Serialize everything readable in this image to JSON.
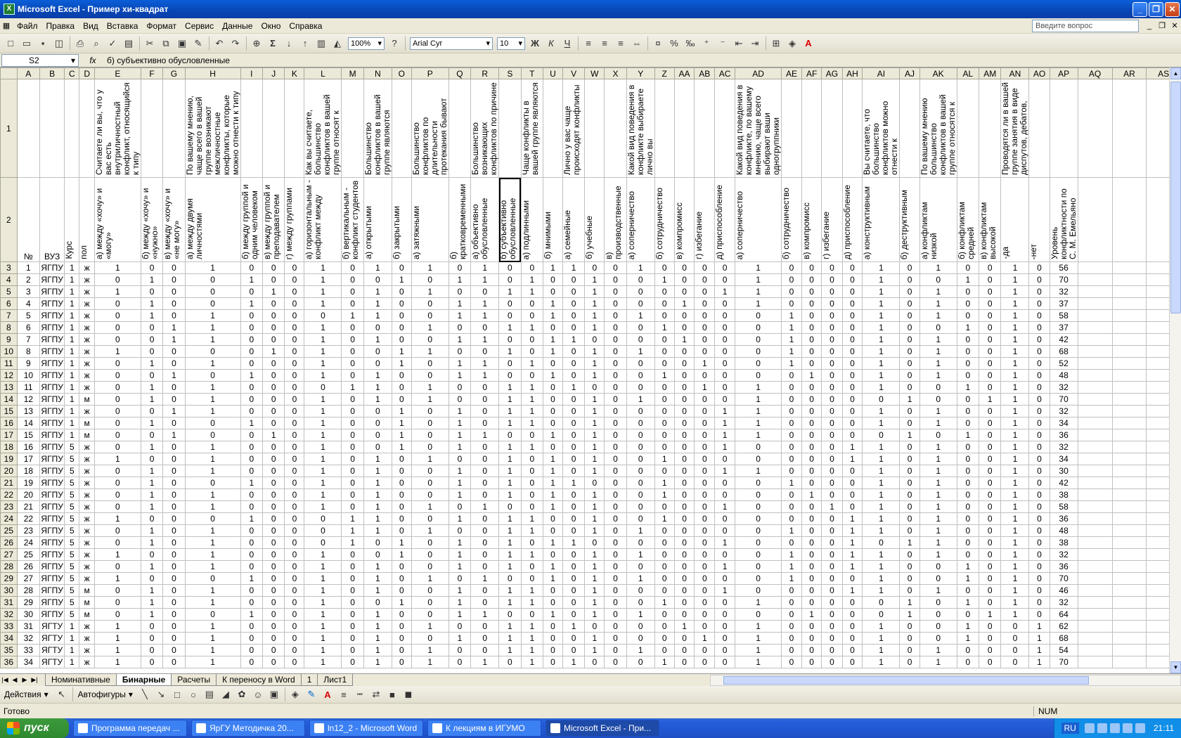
{
  "window": {
    "title": "Microsoft Excel - Пример хи-квадрат"
  },
  "menu": {
    "items": [
      "Файл",
      "Правка",
      "Вид",
      "Вставка",
      "Формат",
      "Сервис",
      "Данные",
      "Окно",
      "Справка"
    ],
    "help_placeholder": "Введите вопрос"
  },
  "toolbar": {
    "zoom": "100%",
    "font": "Arial Cyr",
    "size": "10"
  },
  "formula_bar": {
    "cell": "S2",
    "fx": "fx",
    "content": "б) субъективно обусловленные"
  },
  "columns": [
    "A",
    "B",
    "C",
    "D",
    "E",
    "F",
    "G",
    "H",
    "I",
    "J",
    "K",
    "L",
    "M",
    "N",
    "O",
    "P",
    "Q",
    "R",
    "S",
    "T",
    "U",
    "V",
    "W",
    "X",
    "Y",
    "Z",
    "AA",
    "AB",
    "AC",
    "AD",
    "AE",
    "AF",
    "AG",
    "AH",
    "AI",
    "AJ",
    "AK",
    "AL",
    "AM",
    "AN",
    "AO",
    "AP",
    "AQ",
    "AR",
    "AS"
  ],
  "row1": [
    "",
    "",
    "",
    "",
    "Считаете ли вы, что у вас есть внутриличностный конфликт, относящийся к типу",
    "",
    "",
    "По вашему мнению, чаще всего в вашей группе возникают межличностные конфликты, которые можно отнести к типу",
    "",
    "",
    "",
    "Как вы считаете, большинство конфликтов в вашей группе относят к",
    "",
    "Большинство конфликтов в вашей группе являются",
    "",
    "Большинство конфликтов по длительности протекания бывают",
    "",
    "Большинство возникающих конфликтов по причине",
    "",
    "Чаще конфликты в вашей группе являются",
    "",
    "Лично у вас чаще происходят конфликты",
    "",
    "",
    "Какой вид поведения в конфликте выбираете лично вы",
    "",
    "",
    "",
    "",
    "Какой вид поведения в конфликте, по вашему мнению, чаще всего выбирают ваши одногруппники",
    "",
    "",
    "",
    "",
    "Вы считаете, что большинство конфликтов можно отнести к",
    "",
    "По вашему мнению большинство конфликтов в вашей группе относятся к",
    "",
    "",
    "Проводятся ли в вашей группе занятия в виде диспутов, дебатов,",
    "",
    "",
    "",
    "",
    ""
  ],
  "row2": [
    "№",
    "ВУЗ",
    "Курс",
    "пол",
    "а) между «хочу» и «могу»",
    "б) между «хочу» и «нужно»",
    "в) между «хочу» и «не могу»",
    "а) между двумя личностями",
    "б) между группой и одним человеком",
    "в) между группой и преподавателем",
    "г) между группами",
    "а) горизонтальным - конфликт между",
    "б) вертикальным - конфликт студентов",
    "а) открытыми",
    "б) закрытыми",
    "а) затяжными",
    "б) кратковременными",
    "а) объективно обусловленные",
    "б) субъективно обусловленные",
    "а) подлинными",
    "б) мнимыми",
    "а) семейные",
    "б) учебные",
    "в) производственные",
    "а) соперничество",
    "б) сотрудничество",
    "в) компромисс",
    "г) избегание",
    "д) приспособление",
    "а) соперничество",
    "б) сотрудничество",
    "в) компромисс",
    "г) избегание",
    "д) приспособление",
    "а) конструктивным",
    "б) деструктивным",
    "а) конфликтам низкой",
    "б) конфликтам средней",
    "в) конфликтам высокой",
    "-да",
    "-нет",
    "Уровень конфликтности по С. М. Емельяно",
    "",
    "",
    ""
  ],
  "rows": [
    [
      "1",
      "ЯГПУ",
      "1",
      "ж",
      "1",
      "0",
      "0",
      "1",
      "0",
      "0",
      "0",
      "1",
      "0",
      "1",
      "0",
      "1",
      "0",
      "1",
      "0",
      "0",
      "1",
      "1",
      "0",
      "0",
      "1",
      "0",
      "0",
      "0",
      "0",
      "1",
      "0",
      "0",
      "0",
      "0",
      "1",
      "0",
      "1",
      "0",
      "0",
      "1",
      "0",
      "56"
    ],
    [
      "2",
      "ЯГПУ",
      "1",
      "ж",
      "0",
      "1",
      "0",
      "0",
      "1",
      "0",
      "0",
      "1",
      "0",
      "0",
      "1",
      "0",
      "1",
      "1",
      "0",
      "1",
      "0",
      "0",
      "1",
      "0",
      "0",
      "1",
      "0",
      "0",
      "0",
      "1",
      "0",
      "0",
      "0",
      "0",
      "1",
      "0",
      "0",
      "1",
      "0",
      "1",
      "0",
      "70"
    ],
    [
      "3",
      "ЯГПУ",
      "1",
      "ж",
      "1",
      "0",
      "0",
      "0",
      "0",
      "1",
      "0",
      "1",
      "0",
      "1",
      "0",
      "1",
      "0",
      "0",
      "1",
      "1",
      "0",
      "0",
      "1",
      "0",
      "0",
      "0",
      "0",
      "0",
      "1",
      "1",
      "0",
      "0",
      "0",
      "0",
      "1",
      "0",
      "1",
      "0",
      "0",
      "1",
      "0",
      "32"
    ],
    [
      "4",
      "ЯГПУ",
      "1",
      "ж",
      "0",
      "1",
      "0",
      "0",
      "1",
      "0",
      "0",
      "1",
      "0",
      "1",
      "0",
      "0",
      "1",
      "1",
      "0",
      "0",
      "1",
      "0",
      "1",
      "0",
      "0",
      "0",
      "1",
      "0",
      "0",
      "1",
      "0",
      "0",
      "0",
      "0",
      "1",
      "0",
      "1",
      "0",
      "0",
      "1",
      "0",
      "37"
    ],
    [
      "5",
      "ЯГПУ",
      "1",
      "ж",
      "0",
      "1",
      "0",
      "1",
      "0",
      "0",
      "0",
      "0",
      "1",
      "1",
      "0",
      "0",
      "1",
      "1",
      "0",
      "0",
      "1",
      "0",
      "1",
      "0",
      "1",
      "0",
      "0",
      "0",
      "0",
      "0",
      "1",
      "0",
      "0",
      "0",
      "1",
      "0",
      "1",
      "0",
      "0",
      "1",
      "0",
      "58"
    ],
    [
      "6",
      "ЯГПУ",
      "1",
      "ж",
      "0",
      "0",
      "1",
      "1",
      "0",
      "0",
      "0",
      "1",
      "0",
      "0",
      "0",
      "1",
      "0",
      "0",
      "1",
      "1",
      "0",
      "0",
      "1",
      "0",
      "0",
      "1",
      "0",
      "0",
      "0",
      "0",
      "1",
      "0",
      "0",
      "0",
      "1",
      "0",
      "0",
      "1",
      "0",
      "1",
      "0",
      "37"
    ],
    [
      "7",
      "ЯГПУ",
      "1",
      "ж",
      "0",
      "0",
      "1",
      "1",
      "0",
      "0",
      "0",
      "1",
      "0",
      "1",
      "0",
      "0",
      "1",
      "1",
      "0",
      "0",
      "1",
      "1",
      "0",
      "0",
      "0",
      "0",
      "1",
      "0",
      "0",
      "0",
      "1",
      "0",
      "0",
      "0",
      "1",
      "0",
      "1",
      "0",
      "0",
      "1",
      "0",
      "42"
    ],
    [
      "8",
      "ЯГПУ",
      "1",
      "ж",
      "1",
      "0",
      "0",
      "0",
      "0",
      "1",
      "0",
      "1",
      "0",
      "0",
      "1",
      "1",
      "0",
      "0",
      "1",
      "0",
      "1",
      "0",
      "1",
      "0",
      "1",
      "0",
      "0",
      "0",
      "0",
      "0",
      "1",
      "0",
      "0",
      "0",
      "1",
      "0",
      "1",
      "0",
      "0",
      "1",
      "0",
      "68"
    ],
    [
      "9",
      "ЯГПУ",
      "1",
      "ж",
      "0",
      "1",
      "0",
      "1",
      "0",
      "0",
      "0",
      "1",
      "0",
      "0",
      "1",
      "0",
      "1",
      "1",
      "0",
      "1",
      "0",
      "0",
      "1",
      "0",
      "0",
      "0",
      "0",
      "1",
      "0",
      "0",
      "1",
      "0",
      "0",
      "0",
      "1",
      "0",
      "1",
      "0",
      "0",
      "1",
      "0",
      "52"
    ],
    [
      "10",
      "ЯГПУ",
      "1",
      "ж",
      "0",
      "0",
      "1",
      "0",
      "1",
      "0",
      "0",
      "1",
      "0",
      "1",
      "0",
      "0",
      "1",
      "1",
      "0",
      "0",
      "1",
      "0",
      "1",
      "0",
      "0",
      "1",
      "0",
      "0",
      "0",
      "0",
      "0",
      "1",
      "0",
      "0",
      "1",
      "0",
      "1",
      "0",
      "0",
      "1",
      "0",
      "48"
    ],
    [
      "11",
      "ЯГПУ",
      "1",
      "ж",
      "0",
      "1",
      "0",
      "1",
      "0",
      "0",
      "0",
      "0",
      "1",
      "1",
      "0",
      "1",
      "0",
      "0",
      "1",
      "1",
      "0",
      "1",
      "0",
      "0",
      "0",
      "0",
      "0",
      "1",
      "0",
      "1",
      "0",
      "0",
      "0",
      "0",
      "1",
      "0",
      "0",
      "1",
      "0",
      "1",
      "0",
      "32"
    ],
    [
      "12",
      "ЯГПУ",
      "1",
      "м",
      "0",
      "1",
      "0",
      "1",
      "0",
      "0",
      "0",
      "1",
      "0",
      "1",
      "0",
      "1",
      "0",
      "0",
      "1",
      "1",
      "0",
      "0",
      "1",
      "0",
      "1",
      "0",
      "0",
      "0",
      "0",
      "1",
      "0",
      "0",
      "0",
      "0",
      "0",
      "1",
      "0",
      "0",
      "1",
      "1",
      "0",
      "70"
    ],
    [
      "13",
      "ЯГПУ",
      "1",
      "ж",
      "0",
      "0",
      "1",
      "1",
      "0",
      "0",
      "0",
      "1",
      "0",
      "0",
      "1",
      "0",
      "1",
      "0",
      "1",
      "1",
      "0",
      "0",
      "1",
      "0",
      "0",
      "0",
      "0",
      "0",
      "1",
      "1",
      "0",
      "0",
      "0",
      "0",
      "1",
      "0",
      "1",
      "0",
      "0",
      "1",
      "0",
      "32"
    ],
    [
      "14",
      "ЯГПУ",
      "1",
      "м",
      "0",
      "1",
      "0",
      "0",
      "1",
      "0",
      "0",
      "1",
      "0",
      "0",
      "1",
      "0",
      "1",
      "0",
      "1",
      "1",
      "0",
      "0",
      "1",
      "0",
      "0",
      "0",
      "0",
      "0",
      "1",
      "1",
      "0",
      "0",
      "0",
      "0",
      "1",
      "0",
      "1",
      "0",
      "0",
      "1",
      "0",
      "34"
    ],
    [
      "15",
      "ЯГПУ",
      "1",
      "м",
      "0",
      "0",
      "1",
      "0",
      "0",
      "1",
      "0",
      "1",
      "0",
      "0",
      "1",
      "0",
      "1",
      "1",
      "0",
      "0",
      "1",
      "0",
      "1",
      "0",
      "0",
      "0",
      "0",
      "0",
      "1",
      "1",
      "0",
      "0",
      "0",
      "0",
      "0",
      "1",
      "0",
      "1",
      "0",
      "1",
      "0",
      "36"
    ],
    [
      "16",
      "ЯГПУ",
      "5",
      "ж",
      "0",
      "1",
      "0",
      "1",
      "0",
      "0",
      "0",
      "1",
      "0",
      "0",
      "1",
      "0",
      "1",
      "0",
      "1",
      "1",
      "0",
      "0",
      "1",
      "0",
      "0",
      "0",
      "0",
      "0",
      "1",
      "0",
      "0",
      "0",
      "0",
      "1",
      "1",
      "0",
      "1",
      "0",
      "0",
      "1",
      "0",
      "32"
    ],
    [
      "17",
      "ЯГПУ",
      "5",
      "ж",
      "1",
      "0",
      "0",
      "1",
      "0",
      "0",
      "0",
      "1",
      "0",
      "1",
      "0",
      "1",
      "0",
      "0",
      "1",
      "0",
      "1",
      "0",
      "1",
      "0",
      "0",
      "1",
      "0",
      "0",
      "0",
      "0",
      "0",
      "0",
      "0",
      "1",
      "1",
      "0",
      "1",
      "0",
      "0",
      "1",
      "0",
      "34"
    ],
    [
      "18",
      "ЯГПУ",
      "5",
      "ж",
      "0",
      "1",
      "0",
      "1",
      "0",
      "0",
      "0",
      "1",
      "0",
      "1",
      "0",
      "0",
      "1",
      "0",
      "1",
      "0",
      "1",
      "0",
      "1",
      "0",
      "0",
      "0",
      "0",
      "0",
      "1",
      "1",
      "0",
      "0",
      "0",
      "0",
      "1",
      "0",
      "1",
      "0",
      "0",
      "1",
      "0",
      "30"
    ],
    [
      "19",
      "ЯГПУ",
      "5",
      "ж",
      "0",
      "1",
      "0",
      "0",
      "1",
      "0",
      "0",
      "1",
      "0",
      "1",
      "0",
      "0",
      "1",
      "0",
      "1",
      "0",
      "1",
      "1",
      "0",
      "0",
      "0",
      "1",
      "0",
      "0",
      "0",
      "0",
      "1",
      "0",
      "0",
      "0",
      "1",
      "0",
      "1",
      "0",
      "0",
      "1",
      "0",
      "42"
    ],
    [
      "20",
      "ЯГПУ",
      "5",
      "ж",
      "0",
      "1",
      "0",
      "1",
      "0",
      "0",
      "0",
      "1",
      "0",
      "1",
      "0",
      "0",
      "1",
      "0",
      "1",
      "0",
      "1",
      "0",
      "1",
      "0",
      "0",
      "1",
      "0",
      "0",
      "0",
      "0",
      "0",
      "1",
      "0",
      "0",
      "1",
      "0",
      "1",
      "0",
      "0",
      "1",
      "0",
      "38"
    ],
    [
      "21",
      "ЯГПУ",
      "5",
      "ж",
      "0",
      "1",
      "0",
      "1",
      "0",
      "0",
      "0",
      "1",
      "0",
      "1",
      "0",
      "1",
      "0",
      "1",
      "0",
      "0",
      "1",
      "0",
      "1",
      "0",
      "0",
      "0",
      "0",
      "0",
      "1",
      "0",
      "0",
      "0",
      "1",
      "0",
      "1",
      "0",
      "1",
      "0",
      "0",
      "1",
      "0",
      "58"
    ],
    [
      "22",
      "ЯГПУ",
      "5",
      "ж",
      "1",
      "0",
      "0",
      "0",
      "1",
      "0",
      "0",
      "0",
      "1",
      "1",
      "0",
      "0",
      "1",
      "0",
      "1",
      "1",
      "0",
      "0",
      "1",
      "0",
      "0",
      "1",
      "0",
      "0",
      "0",
      "0",
      "0",
      "0",
      "0",
      "1",
      "1",
      "0",
      "1",
      "0",
      "0",
      "1",
      "0",
      "36"
    ],
    [
      "23",
      "ЯГПУ",
      "5",
      "ж",
      "0",
      "1",
      "0",
      "1",
      "0",
      "0",
      "0",
      "0",
      "1",
      "1",
      "0",
      "1",
      "0",
      "0",
      "1",
      "1",
      "0",
      "0",
      "1",
      "0",
      "1",
      "0",
      "0",
      "0",
      "0",
      "0",
      "1",
      "0",
      "0",
      "1",
      "1",
      "0",
      "1",
      "0",
      "0",
      "1",
      "0",
      "48"
    ],
    [
      "24",
      "ЯГПУ",
      "5",
      "ж",
      "0",
      "1",
      "0",
      "1",
      "0",
      "0",
      "0",
      "0",
      "1",
      "0",
      "1",
      "0",
      "1",
      "0",
      "1",
      "0",
      "1",
      "1",
      "0",
      "0",
      "0",
      "0",
      "0",
      "0",
      "1",
      "0",
      "0",
      "0",
      "0",
      "1",
      "0",
      "1",
      "1",
      "0",
      "0",
      "1",
      "0",
      "38"
    ],
    [
      "25",
      "ЯГПУ",
      "5",
      "ж",
      "1",
      "0",
      "0",
      "1",
      "0",
      "0",
      "0",
      "1",
      "0",
      "0",
      "1",
      "0",
      "1",
      "0",
      "1",
      "1",
      "0",
      "0",
      "1",
      "0",
      "1",
      "0",
      "0",
      "0",
      "0",
      "0",
      "1",
      "0",
      "0",
      "1",
      "1",
      "0",
      "1",
      "0",
      "0",
      "1",
      "0",
      "32"
    ],
    [
      "26",
      "ЯГПУ",
      "5",
      "ж",
      "0",
      "1",
      "0",
      "1",
      "0",
      "0",
      "0",
      "1",
      "0",
      "1",
      "0",
      "0",
      "1",
      "0",
      "1",
      "0",
      "1",
      "0",
      "1",
      "0",
      "0",
      "0",
      "0",
      "0",
      "1",
      "0",
      "1",
      "0",
      "0",
      "1",
      "1",
      "0",
      "0",
      "1",
      "0",
      "1",
      "0",
      "36"
    ],
    [
      "27",
      "ЯГПУ",
      "5",
      "ж",
      "1",
      "0",
      "0",
      "0",
      "1",
      "0",
      "0",
      "1",
      "0",
      "1",
      "0",
      "1",
      "0",
      "1",
      "0",
      "0",
      "1",
      "0",
      "1",
      "0",
      "1",
      "0",
      "0",
      "0",
      "0",
      "0",
      "1",
      "0",
      "0",
      "0",
      "1",
      "0",
      "0",
      "1",
      "0",
      "1",
      "0",
      "70"
    ],
    [
      "28",
      "ЯГПУ",
      "5",
      "м",
      "0",
      "1",
      "0",
      "1",
      "0",
      "0",
      "0",
      "1",
      "0",
      "1",
      "0",
      "0",
      "1",
      "0",
      "1",
      "1",
      "0",
      "0",
      "1",
      "0",
      "0",
      "0",
      "0",
      "0",
      "1",
      "0",
      "0",
      "0",
      "0",
      "1",
      "1",
      "0",
      "1",
      "0",
      "0",
      "1",
      "0",
      "46"
    ],
    [
      "29",
      "ЯГПУ",
      "5",
      "м",
      "0",
      "1",
      "0",
      "1",
      "0",
      "0",
      "0",
      "1",
      "0",
      "0",
      "1",
      "0",
      "1",
      "0",
      "1",
      "1",
      "0",
      "0",
      "1",
      "0",
      "0",
      "1",
      "0",
      "0",
      "0",
      "1",
      "0",
      "0",
      "0",
      "0",
      "0",
      "1",
      "0",
      "1",
      "0",
      "1",
      "0",
      "32"
    ],
    [
      "30",
      "ЯГПУ",
      "5",
      "м",
      "0",
      "1",
      "0",
      "0",
      "1",
      "0",
      "0",
      "1",
      "0",
      "1",
      "0",
      "0",
      "1",
      "1",
      "0",
      "0",
      "1",
      "0",
      "1",
      "0",
      "1",
      "0",
      "0",
      "0",
      "0",
      "0",
      "0",
      "1",
      "0",
      "0",
      "0",
      "1",
      "0",
      "0",
      "1",
      "1",
      "0",
      "64"
    ],
    [
      "31",
      "ЯГТУ",
      "1",
      "ж",
      "1",
      "0",
      "0",
      "1",
      "0",
      "0",
      "0",
      "1",
      "0",
      "1",
      "0",
      "1",
      "0",
      "0",
      "1",
      "1",
      "0",
      "1",
      "0",
      "0",
      "0",
      "0",
      "1",
      "0",
      "0",
      "1",
      "0",
      "0",
      "0",
      "0",
      "1",
      "0",
      "0",
      "1",
      "0",
      "0",
      "1",
      "62"
    ],
    [
      "32",
      "ЯГТУ",
      "1",
      "ж",
      "1",
      "0",
      "0",
      "1",
      "0",
      "0",
      "0",
      "1",
      "0",
      "1",
      "0",
      "0",
      "1",
      "0",
      "1",
      "1",
      "0",
      "0",
      "1",
      "0",
      "0",
      "0",
      "0",
      "1",
      "0",
      "1",
      "0",
      "0",
      "0",
      "0",
      "1",
      "0",
      "0",
      "1",
      "0",
      "0",
      "1",
      "68"
    ],
    [
      "33",
      "ЯГТУ",
      "1",
      "ж",
      "1",
      "0",
      "0",
      "1",
      "0",
      "0",
      "0",
      "1",
      "0",
      "1",
      "0",
      "1",
      "0",
      "0",
      "1",
      "1",
      "0",
      "0",
      "1",
      "0",
      "1",
      "0",
      "0",
      "0",
      "0",
      "1",
      "0",
      "0",
      "0",
      "0",
      "1",
      "0",
      "1",
      "0",
      "0",
      "0",
      "1",
      "54"
    ],
    [
      "34",
      "ЯГТУ",
      "1",
      "ж",
      "1",
      "0",
      "0",
      "1",
      "0",
      "0",
      "0",
      "1",
      "0",
      "1",
      "0",
      "1",
      "0",
      "1",
      "0",
      "1",
      "0",
      "1",
      "0",
      "0",
      "0",
      "1",
      "0",
      "0",
      "0",
      "1",
      "0",
      "0",
      "0",
      "0",
      "1",
      "0",
      "1",
      "0",
      "0",
      "0",
      "1",
      "70"
    ]
  ],
  "sheet_tabs": [
    "Номинативные",
    "Бинарные",
    "Расчеты",
    "К переносу в Word",
    "1",
    "Лист1"
  ],
  "drawing": {
    "actions": "Действия",
    "autoshapes": "Автофигуры"
  },
  "status": {
    "ready": "Готово",
    "num": "NUM"
  },
  "taskbar": {
    "start": "пуск",
    "tasks": [
      "Программа передач ...",
      "ЯрГУ Методичка 20...",
      "ln12_2 - Microsoft Word",
      "К лекциям в ИГУМО",
      "Microsoft Excel - При..."
    ],
    "lang": "RU",
    "clock": "21:11"
  }
}
